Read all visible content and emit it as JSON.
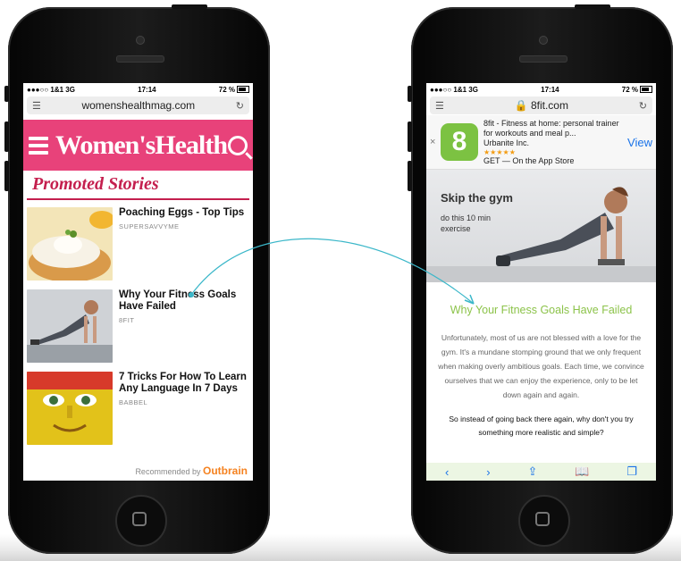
{
  "left_phone": {
    "status": {
      "carrier": "●●●○○ 1&1  3G",
      "time": "17:14",
      "battery": "72 %"
    },
    "url": "womenshealthmag.com",
    "brand": "Women'sHealth",
    "section_title": "Promoted Stories",
    "stories": [
      {
        "title": "Poaching Eggs - Top Tips",
        "source": "SUPERSAVVYME"
      },
      {
        "title": "Why Your Fitness Goals Have Failed",
        "source": "8FIT"
      },
      {
        "title": "7 Tricks For How To Learn Any Language In 7 Days",
        "source": "BABBEL"
      }
    ],
    "recommended_by": "Recommended by",
    "recommender": "Outbrain"
  },
  "right_phone": {
    "status": {
      "carrier": "●●●○○ 1&1  3G",
      "time": "17:14",
      "battery": "72 %"
    },
    "url": "8fit.com",
    "app_banner": {
      "icon_glyph": "8",
      "title": "8fit - Fitness at home: personal trainer for workouts and meal p...",
      "developer": "Urbanite Inc.",
      "stars": "★★★★★",
      "store": "GET — On the App Store",
      "view_label": "View"
    },
    "hero": {
      "headline": "Skip the gym",
      "subline": "do this 10 min exercise"
    },
    "article": {
      "title": "Why Your Fitness Goals Have Failed",
      "paragraph": "Unfortunately, most of us are not blessed with a love for the gym. It's a mundane stomping ground that we only frequent when making overly ambitious goals. Each time, we convince ourselves that we can enjoy the experience, only to be let down again and again.",
      "paragraph2": "So instead of going back there again, why don't you try something more realistic and simple?"
    }
  },
  "colors": {
    "wh_pink": "#e8427a",
    "wh_red": "#c41f4e",
    "fit_green": "#8cc34a",
    "link_blue": "#1a73e8",
    "outbrain_orange": "#f58220"
  },
  "icons": [
    "menu-icon",
    "reload-icon",
    "search-icon",
    "lock-icon",
    "close-icon",
    "share-icon",
    "bookmarks-icon",
    "tabs-icon"
  ]
}
